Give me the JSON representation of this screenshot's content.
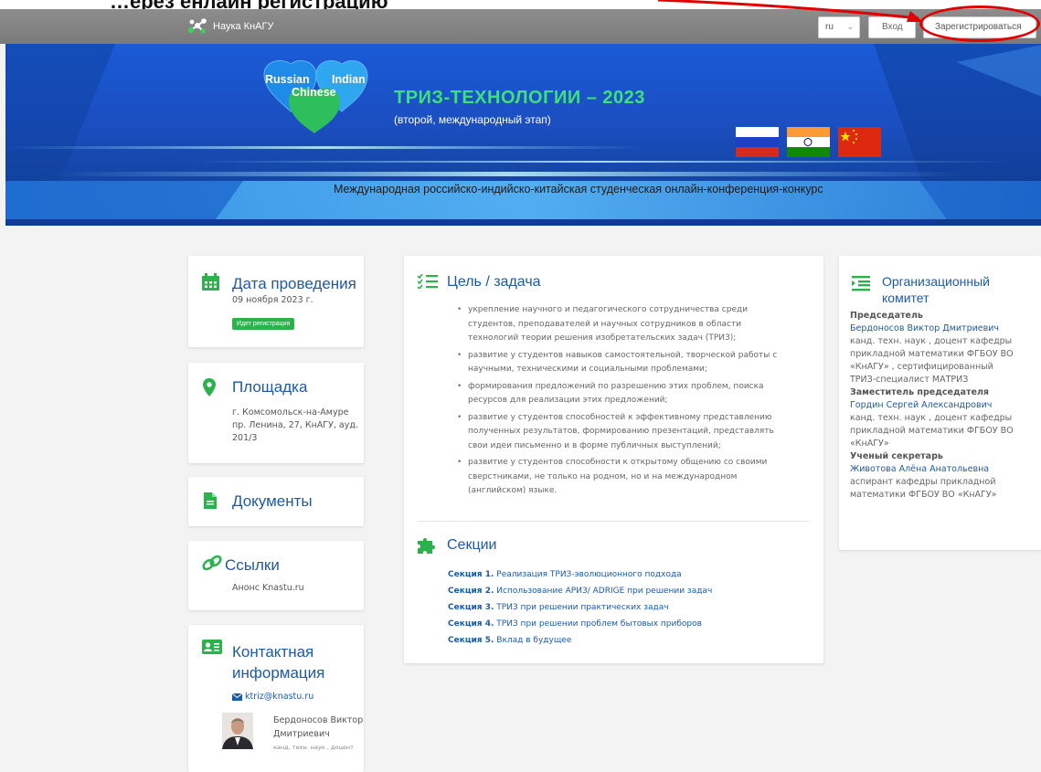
{
  "top_strip": {
    "text": "…ерез   ёнлайн регистрацию"
  },
  "navbar": {
    "brand": "Наука КнАГУ",
    "lang_value": "ru",
    "login": "Вход",
    "register": "Зарегистрироваться"
  },
  "banner": {
    "heart_left": "Russian",
    "heart_right": "Indian",
    "heart_bottom": "Chinese",
    "title": "ТРИЗ-ТЕХНОЛОГИИ – 2023",
    "subtitle": "(второй, международный этап)",
    "tagline": "Международная российско-индийско-китайская студенческая онлайн-конференция-конкурс"
  },
  "date_card": {
    "title": "Дата проведения",
    "date": "09 ноября 2023 г.",
    "badge": "Идет регистрация"
  },
  "venue_card": {
    "title": "Площадка",
    "line1": "г. Комсомольск-на-Амуре",
    "line2": "пр. Ленина, 27, КнАГУ, ауд.",
    "line3": "201/3"
  },
  "docs_card": {
    "title": "Документы"
  },
  "links_card": {
    "title": "Ссылки",
    "link": "Анонс Knastu.ru"
  },
  "contact_card": {
    "title_line1": "Контактная",
    "title_line2": "информация",
    "email": "ktriz@knastu.ru",
    "name_line1": "Бердоносов Виктор",
    "name_line2": "Дмитриевич",
    "position": "канд. техн. наук , доцент"
  },
  "goal_card": {
    "title": "Цель / задача",
    "items": [
      [
        "укрепление научного и педагогического сотрудничества среди",
        "студентов, преподавателей и научных сотрудников в области",
        "технологий теории решения изобретательских задач (ТРИЗ);"
      ],
      [
        "развитие у студентов навыков самостоятельной, творческой работы с",
        "научными, техническими и социальными проблемами;"
      ],
      [
        "формирования предложений по разрешению этих проблем, поиска",
        "ресурсов для реализации этих предложений;"
      ],
      [
        "развитие у студентов способностей к эффективному представлению",
        "полученных результатов, формированию презентаций, представлять",
        "свои идеи письменно и в форме публичных выступлений;"
      ],
      [
        "развитие у студентов способности к открытому общению со своими",
        "сверстниками, не только на родном, но и на международном",
        "(английском) языке."
      ]
    ]
  },
  "sections_card": {
    "title": "Секции",
    "items": [
      {
        "num": "Секция 1.",
        "text": "Реализация ТРИЗ-эволюционного подхода"
      },
      {
        "num": "Секция 2.",
        "text": "Использование АРИЗ/ ADRIGE при решении задач"
      },
      {
        "num": "Секция 3.",
        "text": "ТРИЗ при решении практических задач"
      },
      {
        "num": "Секция 4.",
        "text": "ТРИЗ при решении проблем бытовых приборов"
      },
      {
        "num": "Секция 5.",
        "text": "Вклад в будущее"
      }
    ]
  },
  "org_card": {
    "title_line1": "Организационный",
    "title_line2": "комитет",
    "chair_label": "Председатель",
    "chair_name": "Бердоносов Виктор Дмитриевич",
    "chair_desc": [
      "канд. техн. наук , доцент кафедры",
      "прикладной математики ФГБОУ ВО",
      "«КнАГУ» , сертифицированный",
      "ТРИЗ-специалист МАТРИЗ"
    ],
    "deputy_label": "Заместитель председателя",
    "deputy_name": "Гордин Сергей Александрович",
    "deputy_desc": [
      "канд. техн. наук , доцент кафедры",
      "прикладной математики ФГБОУ ВО",
      "«КнАГУ»"
    ],
    "secretary_label": "Ученый секретарь",
    "secretary_name": "Животова Алёна Анатольевна",
    "secretary_desc": [
      "аспирант кафедры прикладной",
      "математики ФГБОУ ВО «КнАГУ»"
    ]
  },
  "colors": {
    "accent_green": "#2bb24c",
    "link_blue": "#1e5aa8",
    "banner_blue": "#1a5bd6",
    "annotation_red": "#e30000"
  }
}
